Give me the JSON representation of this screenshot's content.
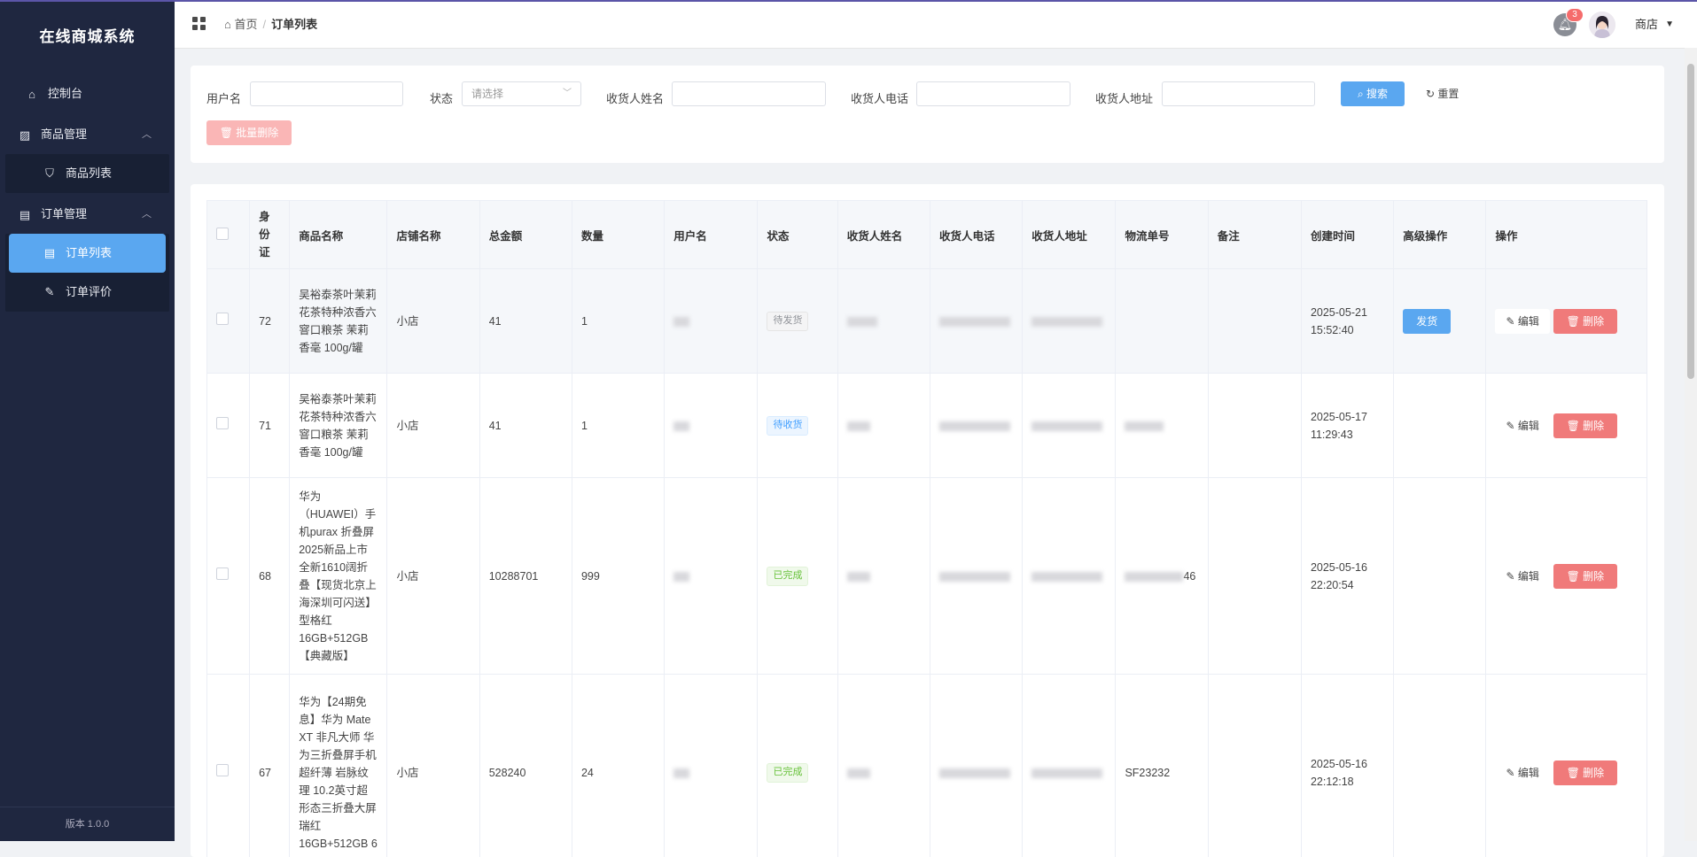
{
  "app": {
    "title": "在线商城系统",
    "version": "版本 1.0.0"
  },
  "sidebar": {
    "dashboard": "控制台",
    "goods_group": "商品管理",
    "goods_list": "商品列表",
    "order_group": "订单管理",
    "order_list": "订单列表",
    "order_review": "订单评价"
  },
  "header": {
    "breadcrumb_home": "首页",
    "breadcrumb_current": "订单列表",
    "notification_count": "3",
    "username": "商店"
  },
  "filters": {
    "username_label": "用户名",
    "status_label": "状态",
    "status_placeholder": "请选择",
    "receiver_name_label": "收货人姓名",
    "receiver_phone_label": "收货人电话",
    "receiver_address_label": "收货人地址",
    "search_button": "搜索",
    "reset_button": "重置",
    "batch_delete_button": "批量删除"
  },
  "table": {
    "columns": [
      "身份证",
      "商品名称",
      "店铺名称",
      "总金额",
      "数量",
      "用户名",
      "状态",
      "收货人姓名",
      "收货人电话",
      "收货人地址",
      "物流单号",
      "备注",
      "创建时间",
      "高级操作",
      "操作"
    ],
    "ship_label": "发货",
    "edit_label": "编辑",
    "delete_label": "删除",
    "rows": [
      {
        "id": "72",
        "product": "吴裕泰茶叶茉莉花茶特种浓香六窨口粮茶 茉莉香毫 100g/罐",
        "shop": "小店",
        "total": "41",
        "qty": "1",
        "status": "待发货",
        "logistics": "",
        "created": "2025-05-21 15:52:40"
      },
      {
        "id": "71",
        "product": "吴裕泰茶叶茉莉花茶特种浓香六窨口粮茶 茉莉香毫 100g/罐",
        "shop": "小店",
        "total": "41",
        "qty": "1",
        "status": "待收货",
        "logistics": "",
        "created": "2025-05-17 11:29:43"
      },
      {
        "id": "68",
        "product": "华为（HUAWEI）手机purax 折叠屏2025新品上市 全新1610阔折叠【现货北京上海深圳可闪送】 型格红 16GB+512GB【典藏版】",
        "shop": "小店",
        "total": "10288701",
        "qty": "999",
        "status": "已完成",
        "logistics": "46",
        "created": "2025-05-16 22:20:54"
      },
      {
        "id": "67",
        "product": "华为【24期免息】华为 Mate XT 非凡大师 华为三折叠屏手机超纤薄 岩脉纹理 10.2英寸超形态三折叠大屏 瑞红 16GB+512GB 6",
        "shop": "小店",
        "total": "528240",
        "qty": "24",
        "status": "已完成",
        "logistics": "SF23232",
        "created": "2025-05-16 22:12:18"
      }
    ]
  },
  "colors": {
    "sidebar_bg": "#1f2740",
    "primary": "#5aa7f0",
    "danger": "#f07a7a",
    "tag_pending": "#909399",
    "tag_receiving": "#409eff",
    "tag_done": "#67c23a"
  }
}
